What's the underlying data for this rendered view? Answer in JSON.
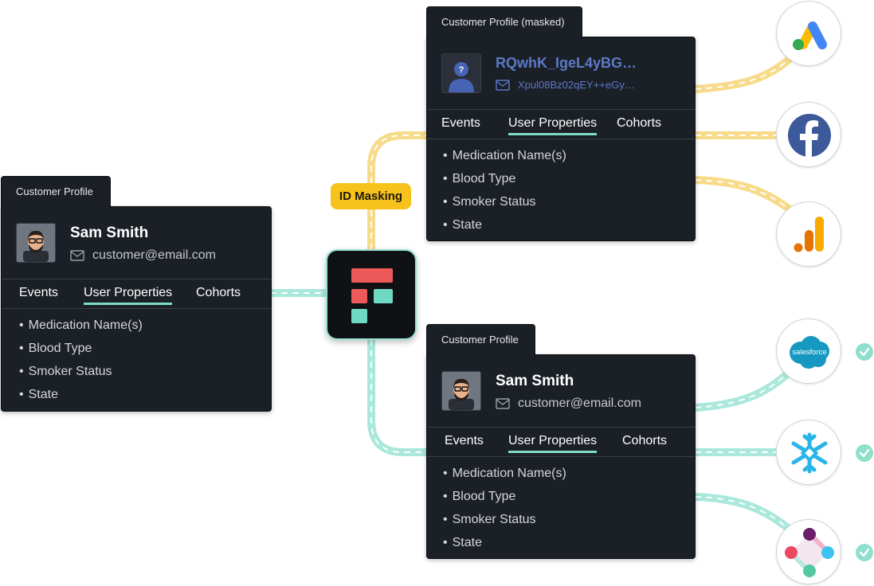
{
  "badge": {
    "label": "ID Masking"
  },
  "source_profile": {
    "tab_label": "Customer Profile",
    "name": "Sam Smith",
    "email": "customer@email.com",
    "tabs": [
      "Events",
      "User Properties",
      "Cohorts"
    ],
    "active_tab": "User Properties",
    "properties": [
      "Medication Name(s)",
      "Blood Type",
      "Smoker Status",
      "State"
    ]
  },
  "masked_profile": {
    "tab_label": "Customer Profile (masked)",
    "name": "RQwhK_IgeL4yBG…",
    "email": "Xpul08Bz02qEY++eGy…",
    "tabs": [
      "Events",
      "User Properties",
      "Cohorts"
    ],
    "active_tab": "User Properties",
    "properties": [
      "Medication Name(s)",
      "Blood Type",
      "Smoker Status",
      "State"
    ]
  },
  "unmasked_profile": {
    "tab_label": "Customer Profile",
    "name": "Sam Smith",
    "email": "customer@email.com",
    "tabs": [
      "Events",
      "User Properties",
      "Cohorts"
    ],
    "active_tab": "User Properties",
    "properties": [
      "Medication Name(s)",
      "Blood Type",
      "Smoker Status",
      "State"
    ]
  },
  "destinations": [
    {
      "icon": "google-ads-icon",
      "checked": false
    },
    {
      "icon": "facebook-icon",
      "checked": false
    },
    {
      "icon": "google-analytics-icon",
      "checked": false
    },
    {
      "icon": "salesforce-icon",
      "logo_text": "salesforce",
      "checked": true
    },
    {
      "icon": "snowflake-icon",
      "checked": true
    },
    {
      "icon": "segment-diamond-icon",
      "checked": true
    }
  ],
  "colors": {
    "masked_path": "#f7db8a",
    "clear_path": "#a9e8da",
    "card_bg": "#1b1f26",
    "accent_underline": "#7ddcc7",
    "masked_text": "#5b79c6",
    "badge": "#f7c21b",
    "check": "#8ee0cb"
  }
}
